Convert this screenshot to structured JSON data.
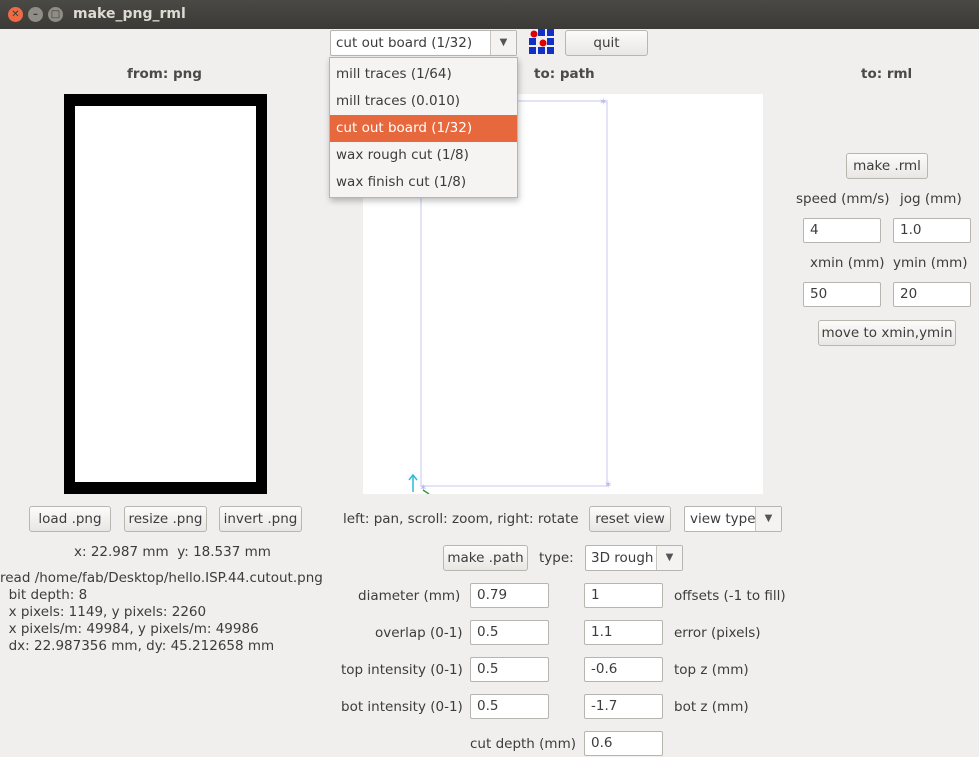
{
  "window": {
    "title": "make_png_rml"
  },
  "toolbar": {
    "process_selected": "cut out board (1/32)",
    "process_options": [
      "mill traces (1/64)",
      "mill traces (0.010)",
      "cut out board (1/32)",
      "wax rough cut (1/8)",
      "wax finish cut (1/8)"
    ],
    "quit_label": "quit",
    "colors": {
      "grid_red": "#e00000",
      "grid_blue": "#1030c8"
    }
  },
  "headers": {
    "from_png": "from: png",
    "to_path": "to: path",
    "to_rml": "to: rml"
  },
  "png_panel": {
    "load_label": "load .png",
    "resize_label": "resize .png",
    "invert_label": "invert .png",
    "coords": "x: 22.987 mm  y: 18.537 mm",
    "info_lines": [
      "read /home/fab/Desktop/hello.ISP.44.cutout.png",
      "  bit depth: 8",
      "  x pixels: 1149, y pixels: 2260",
      "  x pixels/m: 49984, y pixels/m: 49986",
      "  dx: 22.987356 mm, dy: 45.212658 mm"
    ]
  },
  "path_panel": {
    "hint": "left: pan, scroll: zoom, right: rotate",
    "reset_view_label": "reset view",
    "view_type_label": "view type",
    "make_path_label": "make .path",
    "type_label": "type:",
    "type_value": "3D rough",
    "fields": {
      "diameter_label": "diameter (mm)",
      "diameter_value": "0.79",
      "offsets_label": "offsets (-1 to fill)",
      "offsets_value": "1",
      "overlap_label": "overlap (0-1)",
      "overlap_value": "0.5",
      "error_label": "error (pixels)",
      "error_value": "1.1",
      "top_intensity_label": "top intensity (0-1)",
      "top_intensity_value": "0.5",
      "top_z_label": "top z (mm)",
      "top_z_value": "-0.6",
      "bot_intensity_label": "bot intensity (0-1)",
      "bot_intensity_value": "0.5",
      "bot_z_label": "bot z (mm)",
      "bot_z_value": "-1.7",
      "cut_depth_label": "cut depth (mm)",
      "cut_depth_value": "0.6"
    }
  },
  "rml_panel": {
    "make_rml_label": "make .rml",
    "speed_label": "speed (mm/s)",
    "speed_value": "4",
    "jog_label": "jog (mm)",
    "jog_value": "1.0",
    "xmin_label": "xmin (mm)",
    "xmin_value": "50",
    "ymin_label": "ymin (mm)",
    "ymin_value": "20",
    "move_label": "move to xmin,ymin"
  }
}
